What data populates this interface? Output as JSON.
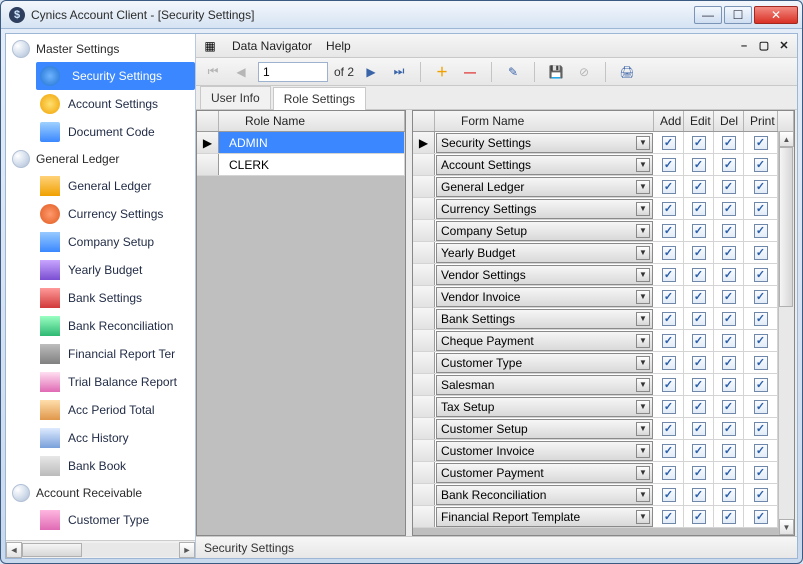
{
  "window": {
    "title": "Cynics Account Client - [Security Settings]"
  },
  "menubar": {
    "data_navigator": "Data Navigator",
    "help": "Help"
  },
  "toolbar": {
    "page_current": "1",
    "page_of": "of 2"
  },
  "sidebar": {
    "groups": [
      {
        "label": "Master Settings",
        "items": [
          {
            "label": "Security Settings",
            "icon": "shield-icon",
            "selected": true
          },
          {
            "label": "Account Settings",
            "icon": "dollar-icon"
          },
          {
            "label": "Document Code",
            "icon": "document-icon"
          }
        ]
      },
      {
        "label": "General Ledger",
        "items": [
          {
            "label": "General Ledger",
            "icon": "ledger-icon"
          },
          {
            "label": "Currency Settings",
            "icon": "currency-icon"
          },
          {
            "label": "Company Setup",
            "icon": "company-icon"
          },
          {
            "label": "Yearly Budget",
            "icon": "budget-icon"
          },
          {
            "label": "Bank Settings",
            "icon": "bank-icon"
          },
          {
            "label": "Bank Reconciliation",
            "icon": "reconcile-icon"
          },
          {
            "label": "Financial Report Ter",
            "icon": "finreport-icon"
          },
          {
            "label": "Trial Balance Report",
            "icon": "trial-icon"
          },
          {
            "label": "Acc Period Total",
            "icon": "period-icon"
          },
          {
            "label": "Acc History",
            "icon": "history-icon"
          },
          {
            "label": "Bank Book",
            "icon": "bankbook-icon"
          }
        ]
      },
      {
        "label": "Account Receivable",
        "items": [
          {
            "label": "Customer Type",
            "icon": "customer-icon"
          }
        ]
      }
    ]
  },
  "tabs": {
    "user_info": "User Info",
    "role_settings": "Role Settings",
    "active_index": 1
  },
  "role_grid": {
    "header": "Role Name",
    "rows": [
      {
        "name": "ADMIN",
        "selected": true
      },
      {
        "name": "CLERK"
      }
    ]
  },
  "form_grid": {
    "headers": {
      "form": "Form Name",
      "add": "Add",
      "edit": "Edit",
      "del": "Del",
      "print": "Print"
    },
    "rows": [
      {
        "form": "Security Settings",
        "add": true,
        "edit": true,
        "del": true,
        "print": true,
        "selected": true
      },
      {
        "form": "Account Settings",
        "add": true,
        "edit": true,
        "del": true,
        "print": true
      },
      {
        "form": "General Ledger",
        "add": true,
        "edit": true,
        "del": true,
        "print": true
      },
      {
        "form": "Currency Settings",
        "add": true,
        "edit": true,
        "del": true,
        "print": true
      },
      {
        "form": "Company Setup",
        "add": true,
        "edit": true,
        "del": true,
        "print": true
      },
      {
        "form": "Yearly Budget",
        "add": true,
        "edit": true,
        "del": true,
        "print": true
      },
      {
        "form": "Vendor Settings",
        "add": true,
        "edit": true,
        "del": true,
        "print": true
      },
      {
        "form": "Vendor Invoice",
        "add": true,
        "edit": true,
        "del": true,
        "print": true
      },
      {
        "form": "Bank Settings",
        "add": true,
        "edit": true,
        "del": true,
        "print": true
      },
      {
        "form": "Cheque Payment",
        "add": true,
        "edit": true,
        "del": true,
        "print": true
      },
      {
        "form": "Customer Type",
        "add": true,
        "edit": true,
        "del": true,
        "print": true
      },
      {
        "form": "Salesman",
        "add": true,
        "edit": true,
        "del": true,
        "print": true
      },
      {
        "form": "Tax Setup",
        "add": true,
        "edit": true,
        "del": true,
        "print": true
      },
      {
        "form": "Customer Setup",
        "add": true,
        "edit": true,
        "del": true,
        "print": true
      },
      {
        "form": "Customer Invoice",
        "add": true,
        "edit": true,
        "del": true,
        "print": true
      },
      {
        "form": "Customer Payment",
        "add": true,
        "edit": true,
        "del": true,
        "print": true
      },
      {
        "form": "Bank Reconciliation",
        "add": true,
        "edit": true,
        "del": true,
        "print": true
      },
      {
        "form": "Financial Report Template",
        "add": true,
        "edit": true,
        "del": true,
        "print": true
      }
    ]
  },
  "statusbar": {
    "text": "Security Settings"
  },
  "icon_class": {
    "shield-icon": "ic-shield",
    "dollar-icon": "ic-dol",
    "document-icon": "ic-doc",
    "ledger-icon": "ic-gen",
    "currency-icon": "ic-cur",
    "company-icon": "ic-co",
    "budget-icon": "ic-yr",
    "bank-icon": "ic-bank",
    "reconcile-icon": "ic-rec",
    "finreport-icon": "ic-fin",
    "trial-icon": "ic-trial",
    "period-icon": "ic-per",
    "history-icon": "ic-hist",
    "bankbook-icon": "ic-bb",
    "customer-icon": "ic-cust"
  }
}
